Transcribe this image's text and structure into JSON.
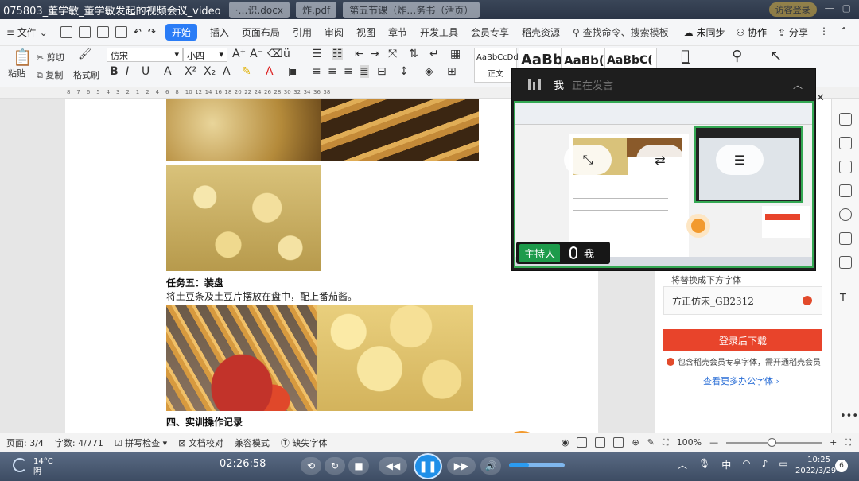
{
  "titlebar": {
    "video_title": "075803_董学敏_董学敏发起的视频会议_video",
    "bg_tabs": [
      "·…识.docx",
      "炸.pdf",
      "第五节课（炸…务书（活页）"
    ],
    "user_label": "访客登录"
  },
  "menubar": {
    "file": "文件",
    "tabs": [
      "开始",
      "插入",
      "页面布局",
      "引用",
      "审阅",
      "视图",
      "章节",
      "开发工具",
      "会员专享",
      "稻壳资源"
    ],
    "search": "查找命令、搜索模板",
    "right": [
      "未同步",
      "协作",
      "分享"
    ]
  },
  "ribbon": {
    "paste": "粘贴",
    "cut": "剪切",
    "copy": "复制",
    "format_painter": "格式刷",
    "font_name": "仿宋",
    "font_size": "小四",
    "styles": [
      "AaBbCcDd",
      "AaBb",
      "AaBb(",
      "AaBbC("
    ],
    "style_normal": "正文"
  },
  "ruler_marks": [
    "8",
    "7",
    "6",
    "5",
    "4",
    "3",
    "2",
    "1",
    "2",
    "4",
    "6",
    "8",
    "10",
    "12",
    "14",
    "16",
    "18",
    "20",
    "22",
    "24",
    "26",
    "28",
    "30",
    "32",
    "34",
    "36",
    "38"
  ],
  "document": {
    "task5_heading": "任务五：装盘",
    "task5_text": "将土豆条及土豆片摆放在盘中，配上番茄酱。",
    "section4_heading": "四、实训操作记录"
  },
  "meeting": {
    "me_label": "我",
    "speaking": "正在发言",
    "host_label": "主持人",
    "mic_user": "我"
  },
  "side_panel": {
    "replace_label": "将替换成下方字体",
    "font_name": "方正仿宋_GB2312",
    "download_button": "登录后下载",
    "member_note": "包含稻壳会员专享字体，需开通稻壳会员",
    "more_link": "查看更多办公字体 ›"
  },
  "statusbar": {
    "page": "页面: 3/4",
    "words": "字数: 4/771",
    "spellcheck": "拼写检查",
    "proofread": "文档校对",
    "compat": "兼容模式",
    "missing_fonts": "缺失字体",
    "zoom": "100%"
  },
  "player": {
    "temp": "14°C",
    "weather": "阴",
    "time": "02:26:58",
    "volume_fraction": 0.35,
    "ime": "中",
    "clock_time": "10:25",
    "clock_date": "2022/3/29",
    "notif_count": "6"
  },
  "colors": {
    "accent": "#2a7cf6",
    "download_red": "#e8442b",
    "host_green": "#1d9b4b",
    "share_border": "#34a853"
  }
}
